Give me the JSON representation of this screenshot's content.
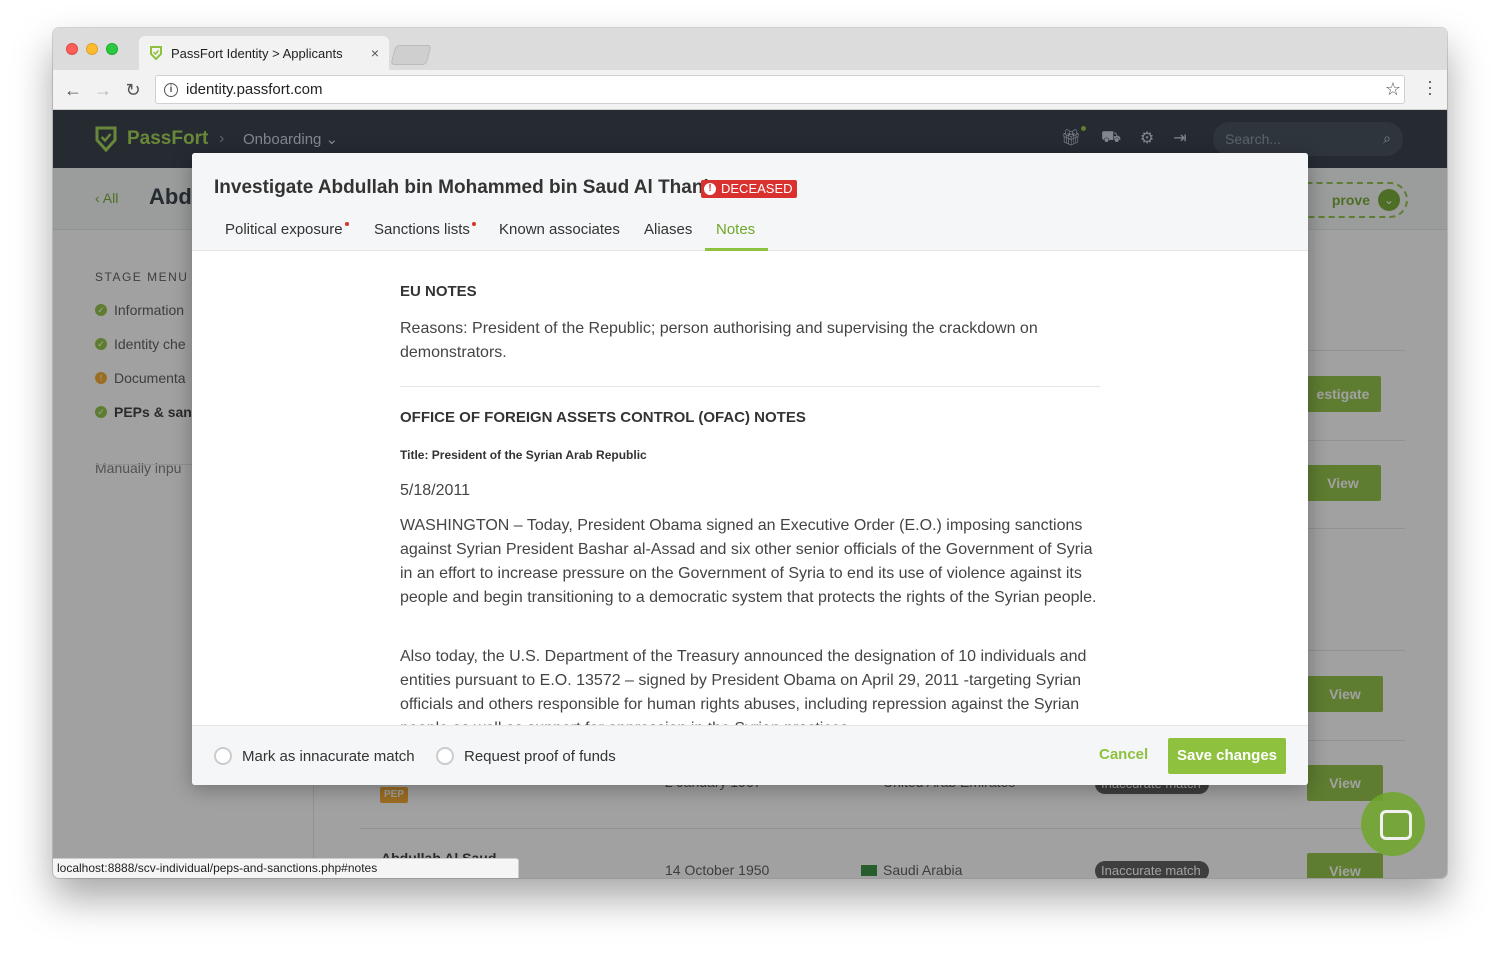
{
  "browser": {
    "tab_title": "PassFort Identity > Applicants",
    "tab_close": "×",
    "url": "identity.passfort.com",
    "status_url": "localhost:8888/scv-individual/peps-and-sanctions.php#notes"
  },
  "app": {
    "brand": "PassFort",
    "crumb_sep": "›",
    "crumb": "Onboarding ⌄",
    "search_placeholder": "Search...",
    "back_label": "‹ All",
    "applicant_title_partial": "Abd",
    "approve_label": "prove",
    "stage_menu": {
      "heading": "STAGE MENU",
      "items": [
        {
          "label": "Information",
          "status": "ok"
        },
        {
          "label": "Identity che",
          "status": "ok"
        },
        {
          "label": "Documenta",
          "status": "warn"
        },
        {
          "label": "PEPs & sanc",
          "status": "ok"
        }
      ],
      "manual": "Manually inpu"
    },
    "bg_buttons": {
      "investigate": "estigate",
      "view": "View"
    },
    "bg_row": {
      "name": "Abdullah Al Saud",
      "dob": "14 October 1950",
      "country": "Saudi Arabia",
      "pill": "Inaccurate match",
      "pep": "PEP",
      "dob_partial": "2 January 1967",
      "country_partial": "United Arab Emirates"
    }
  },
  "modal": {
    "title": "Investigate Abdullah bin Mohammed bin Saud Al Thani",
    "badge": "DECEASED",
    "tabs": [
      {
        "label": "Political exposure",
        "alert": true
      },
      {
        "label": "Sanctions lists",
        "alert": true
      },
      {
        "label": "Known associates",
        "alert": false
      },
      {
        "label": "Aliases",
        "alert": false
      },
      {
        "label": "Notes",
        "alert": false,
        "active": true
      }
    ],
    "eu_heading": "EU NOTES",
    "eu_text": "Reasons: President of the Republic; person authorising and supervising the crackdown on demonstrators.",
    "ofac_heading": "OFFICE OF FOREIGN ASSETS CONTROL (OFAC) NOTES",
    "ofac_title": "Title: President of the Syrian Arab Republic",
    "ofac_date": "5/18/2011",
    "ofac_p1": "WASHINGTON – Today, President Obama signed an Executive Order (E.O.) imposing sanctions against Syrian President Bashar al-Assad and six other senior officials of the Government of Syria in an effort to increase pressure on the Government of Syria to end its use of violence against its people and begin transitioning to a democratic system that protects the rights of the Syrian people.",
    "ofac_p2": "Also today, the U.S. Department of the Treasury announced the designation of 10 individuals and entities pursuant to E.O. 13572 – signed by President Obama on April 29, 2011 -targeting Syrian officials and others responsible for human rights abuses, including repression against the Syrian people as well as support for oppression in the Syrian practices.",
    "footer": {
      "mark_inaccurate": "Mark as innacurate match",
      "request_proof": "Request proof of funds",
      "cancel": "Cancel",
      "save": "Save changes"
    }
  },
  "colors": {
    "brand_green": "#8ec13e",
    "danger_red": "#d9322e",
    "nav_dark": "#2b3540"
  }
}
